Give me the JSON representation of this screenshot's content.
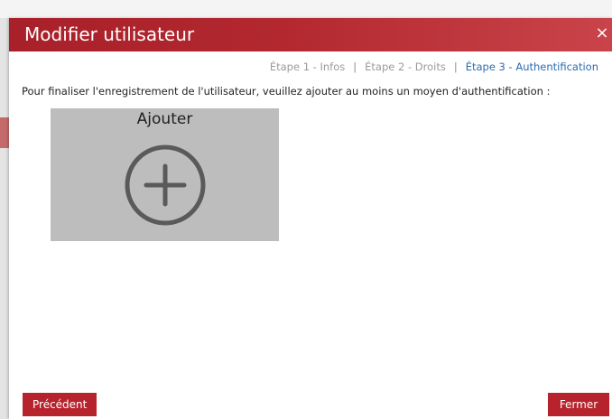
{
  "dialog": {
    "title": "Modifier utilisateur",
    "close_symbol": "×"
  },
  "steps": [
    {
      "label": "Étape 1 - Infos",
      "active": false
    },
    {
      "label": "Étape 2 - Droits",
      "active": false
    },
    {
      "label": "Étape 3 - Authentification",
      "active": true
    }
  ],
  "step_separator": "|",
  "instruction": "Pour finaliser l'enregistrement de l'utilisateur, veuillez ajouter au moins un moyen d'authentification :",
  "add_tile": {
    "label": "Ajouter",
    "icon": "plus-circle-icon"
  },
  "footer": {
    "previous_label": "Précédent",
    "close_label": "Fermer"
  },
  "colors": {
    "header": "#b3282f",
    "button": "#b7232c",
    "active_step": "#2b6cb0",
    "tile": "#bdbdbd"
  }
}
